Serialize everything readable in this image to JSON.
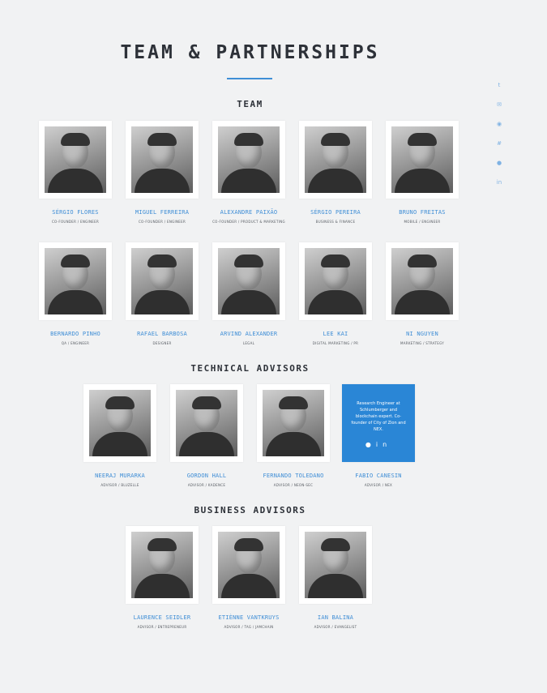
{
  "page": {
    "title": "TEAM & PARTNERSHIPS"
  },
  "social": [
    "twitter-icon",
    "email-icon",
    "reddit-icon",
    "slack-icon",
    "github-icon",
    "linkedin-icon"
  ],
  "sections": {
    "team": {
      "title": "TEAM"
    },
    "technical": {
      "title": "TECHNICAL ADVISORS"
    },
    "business": {
      "title": "BUSINESS ADVISORS"
    }
  },
  "team": [
    {
      "name": "SÉRGIO FLORES",
      "role": "CO-FOUNDER / ENGINEER"
    },
    {
      "name": "MIGUEL FERREIRA",
      "role": "CO-FOUNDER / ENGINEER"
    },
    {
      "name": "ALEXANDRE PAIXÃO",
      "role": "CO-FOUNDER / PRODUCT & MARKETING"
    },
    {
      "name": "SÉRGIO PEREIRA",
      "role": "BUSINESS & FINANCE"
    },
    {
      "name": "BRUNO FREITAS",
      "role": "MOBILE / ENGINEER"
    },
    {
      "name": "BERNARDO PINHO",
      "role": "QA / ENGINEER"
    },
    {
      "name": "RAFAEL BARBOSA",
      "role": "DESIGNER"
    },
    {
      "name": "ARVIND ALEXANDER",
      "role": "LEGAL"
    },
    {
      "name": "LEE KAI",
      "role": "DIGITAL MARKETING / PR"
    },
    {
      "name": "NI NGUYEN",
      "role": "MARKETING / STRATEGY"
    }
  ],
  "technical": [
    {
      "name": "NEERAJ MURARKA",
      "role": "ADVISOR / BLUZELLE"
    },
    {
      "name": "GORDON HALL",
      "role": "ADVISOR / KADENCE"
    },
    {
      "name": "FERNANDO TOLEDANO",
      "role": "ADVISOR / NEON-SEC"
    },
    {
      "name": "FABIO CANESIN",
      "role": "ADVISOR / NEX",
      "bio": "Research Engineer at Schlumberger and blockchain expert. Co-founder of City of Zion and NEX."
    }
  ],
  "business": [
    {
      "name": "LAURENCE SEIDLER",
      "role": "ADVISOR / ENTREPRENEUR"
    },
    {
      "name": "ETIÈNNE VANTKRUYS",
      "role": "ADVISOR / TAG / JAMCHAIN"
    },
    {
      "name": "IAN BALINA",
      "role": "ADVISOR / EVANGELIST"
    }
  ]
}
